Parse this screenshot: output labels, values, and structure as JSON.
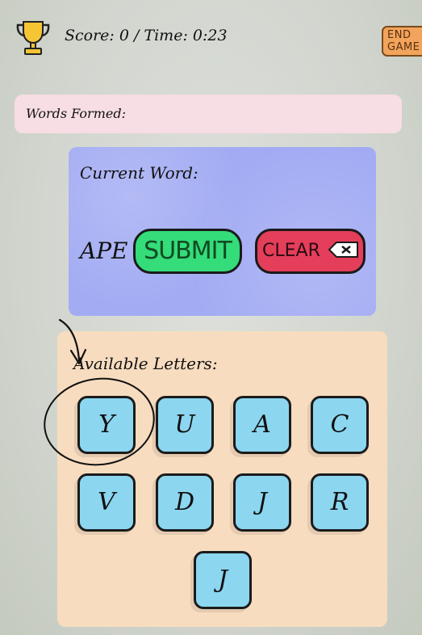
{
  "header": {
    "trophy_icon": "trophy-icon",
    "score_text": "Score: 0 / Time: 0:23",
    "end_game_line1": "END",
    "end_game_line2": "GAME"
  },
  "words_formed": {
    "label": "Words Formed:"
  },
  "current": {
    "label": "Current Word:",
    "word": "APE",
    "submit_label": "SUBMIT",
    "clear_label": "CLEAR",
    "clear_icon": "backspace-icon"
  },
  "available": {
    "label": "Available Letters:",
    "letters": [
      "Y",
      "U",
      "A",
      "C",
      "V",
      "D",
      "J",
      "R",
      "J"
    ]
  },
  "colors": {
    "submit": "#34dc7a",
    "clear": "#e43e5a",
    "tile": "#8cd6f0",
    "current_panel": "#a3acf3",
    "letters_panel": "#f7dcbf",
    "words_panel": "#f7dde4",
    "end_game": "#f2a45c"
  }
}
